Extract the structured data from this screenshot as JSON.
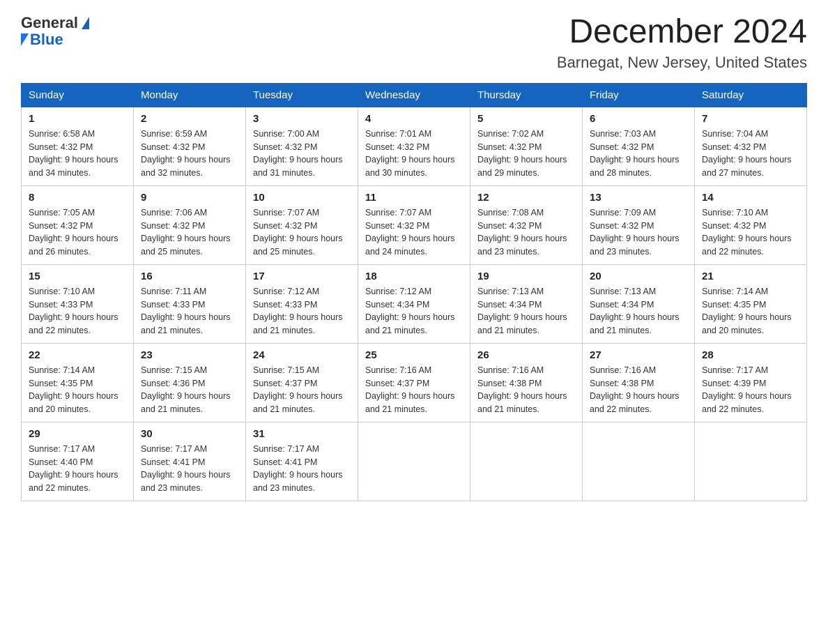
{
  "header": {
    "logo_text_general": "General",
    "logo_text_blue": "Blue",
    "month_year": "December 2024",
    "location": "Barnegat, New Jersey, United States"
  },
  "weekdays": [
    "Sunday",
    "Monday",
    "Tuesday",
    "Wednesday",
    "Thursday",
    "Friday",
    "Saturday"
  ],
  "weeks": [
    [
      {
        "day": "1",
        "sunrise": "6:58 AM",
        "sunset": "4:32 PM",
        "daylight": "9 hours and 34 minutes."
      },
      {
        "day": "2",
        "sunrise": "6:59 AM",
        "sunset": "4:32 PM",
        "daylight": "9 hours and 32 minutes."
      },
      {
        "day": "3",
        "sunrise": "7:00 AM",
        "sunset": "4:32 PM",
        "daylight": "9 hours and 31 minutes."
      },
      {
        "day": "4",
        "sunrise": "7:01 AM",
        "sunset": "4:32 PM",
        "daylight": "9 hours and 30 minutes."
      },
      {
        "day": "5",
        "sunrise": "7:02 AM",
        "sunset": "4:32 PM",
        "daylight": "9 hours and 29 minutes."
      },
      {
        "day": "6",
        "sunrise": "7:03 AM",
        "sunset": "4:32 PM",
        "daylight": "9 hours and 28 minutes."
      },
      {
        "day": "7",
        "sunrise": "7:04 AM",
        "sunset": "4:32 PM",
        "daylight": "9 hours and 27 minutes."
      }
    ],
    [
      {
        "day": "8",
        "sunrise": "7:05 AM",
        "sunset": "4:32 PM",
        "daylight": "9 hours and 26 minutes."
      },
      {
        "day": "9",
        "sunrise": "7:06 AM",
        "sunset": "4:32 PM",
        "daylight": "9 hours and 25 minutes."
      },
      {
        "day": "10",
        "sunrise": "7:07 AM",
        "sunset": "4:32 PM",
        "daylight": "9 hours and 25 minutes."
      },
      {
        "day": "11",
        "sunrise": "7:07 AM",
        "sunset": "4:32 PM",
        "daylight": "9 hours and 24 minutes."
      },
      {
        "day": "12",
        "sunrise": "7:08 AM",
        "sunset": "4:32 PM",
        "daylight": "9 hours and 23 minutes."
      },
      {
        "day": "13",
        "sunrise": "7:09 AM",
        "sunset": "4:32 PM",
        "daylight": "9 hours and 23 minutes."
      },
      {
        "day": "14",
        "sunrise": "7:10 AM",
        "sunset": "4:32 PM",
        "daylight": "9 hours and 22 minutes."
      }
    ],
    [
      {
        "day": "15",
        "sunrise": "7:10 AM",
        "sunset": "4:33 PM",
        "daylight": "9 hours and 22 minutes."
      },
      {
        "day": "16",
        "sunrise": "7:11 AM",
        "sunset": "4:33 PM",
        "daylight": "9 hours and 21 minutes."
      },
      {
        "day": "17",
        "sunrise": "7:12 AM",
        "sunset": "4:33 PM",
        "daylight": "9 hours and 21 minutes."
      },
      {
        "day": "18",
        "sunrise": "7:12 AM",
        "sunset": "4:34 PM",
        "daylight": "9 hours and 21 minutes."
      },
      {
        "day": "19",
        "sunrise": "7:13 AM",
        "sunset": "4:34 PM",
        "daylight": "9 hours and 21 minutes."
      },
      {
        "day": "20",
        "sunrise": "7:13 AM",
        "sunset": "4:34 PM",
        "daylight": "9 hours and 21 minutes."
      },
      {
        "day": "21",
        "sunrise": "7:14 AM",
        "sunset": "4:35 PM",
        "daylight": "9 hours and 20 minutes."
      }
    ],
    [
      {
        "day": "22",
        "sunrise": "7:14 AM",
        "sunset": "4:35 PM",
        "daylight": "9 hours and 20 minutes."
      },
      {
        "day": "23",
        "sunrise": "7:15 AM",
        "sunset": "4:36 PM",
        "daylight": "9 hours and 21 minutes."
      },
      {
        "day": "24",
        "sunrise": "7:15 AM",
        "sunset": "4:37 PM",
        "daylight": "9 hours and 21 minutes."
      },
      {
        "day": "25",
        "sunrise": "7:16 AM",
        "sunset": "4:37 PM",
        "daylight": "9 hours and 21 minutes."
      },
      {
        "day": "26",
        "sunrise": "7:16 AM",
        "sunset": "4:38 PM",
        "daylight": "9 hours and 21 minutes."
      },
      {
        "day": "27",
        "sunrise": "7:16 AM",
        "sunset": "4:38 PM",
        "daylight": "9 hours and 22 minutes."
      },
      {
        "day": "28",
        "sunrise": "7:17 AM",
        "sunset": "4:39 PM",
        "daylight": "9 hours and 22 minutes."
      }
    ],
    [
      {
        "day": "29",
        "sunrise": "7:17 AM",
        "sunset": "4:40 PM",
        "daylight": "9 hours and 22 minutes."
      },
      {
        "day": "30",
        "sunrise": "7:17 AM",
        "sunset": "4:41 PM",
        "daylight": "9 hours and 23 minutes."
      },
      {
        "day": "31",
        "sunrise": "7:17 AM",
        "sunset": "4:41 PM",
        "daylight": "9 hours and 23 minutes."
      },
      null,
      null,
      null,
      null
    ]
  ]
}
